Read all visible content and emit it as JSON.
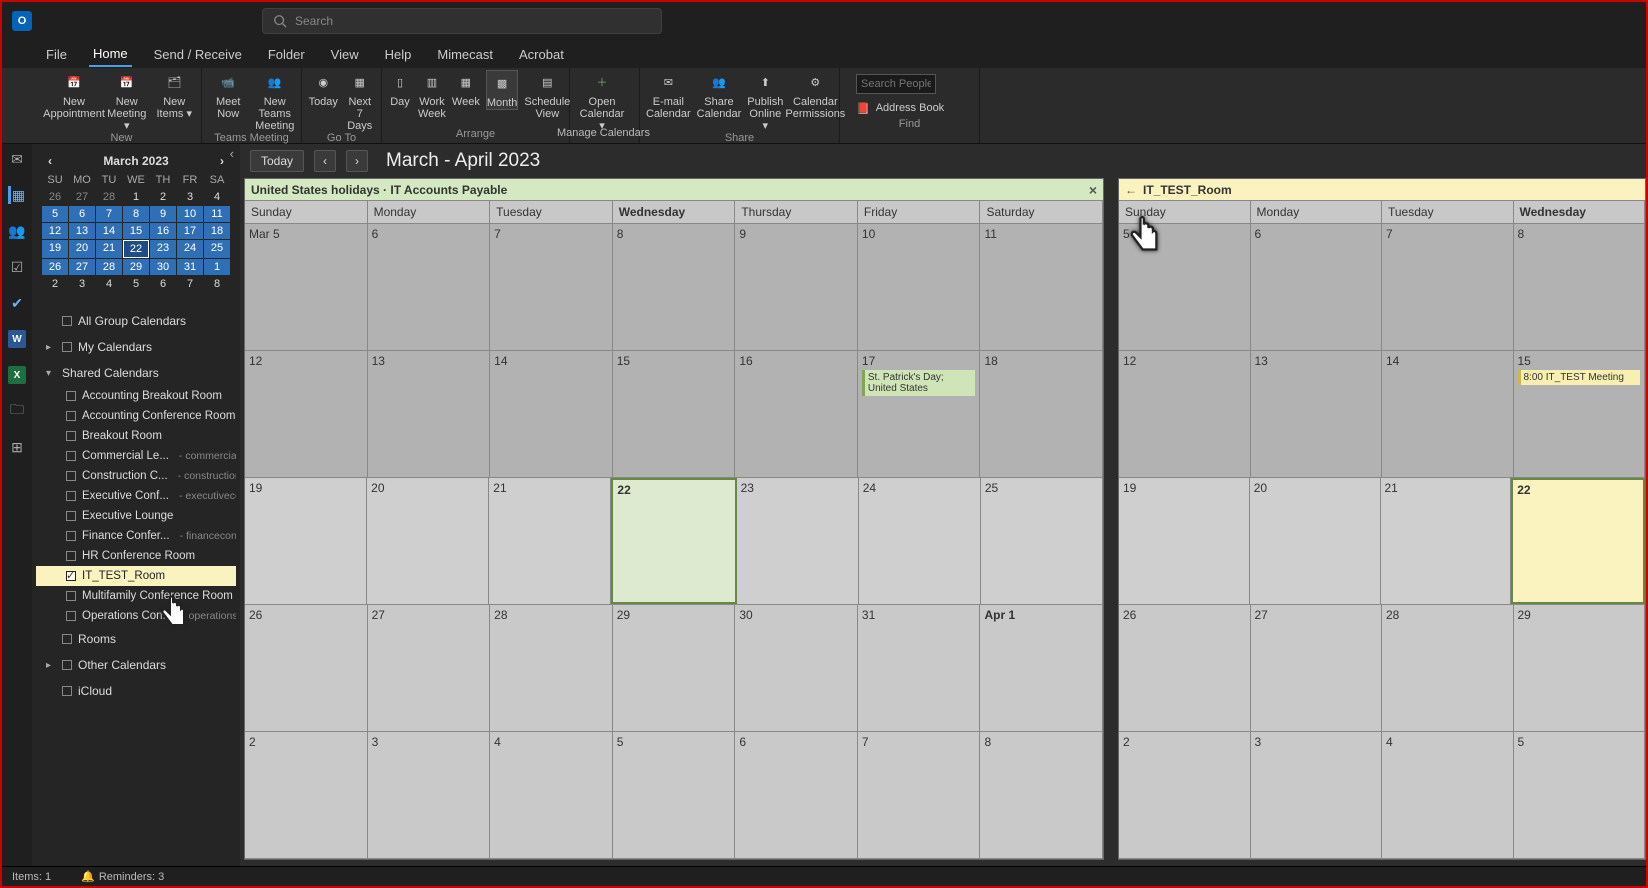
{
  "titlebar": {
    "search_placeholder": "Search"
  },
  "menu": [
    "File",
    "Home",
    "Send / Receive",
    "Folder",
    "View",
    "Help",
    "Mimecast",
    "Acrobat"
  ],
  "menu_active_index": 1,
  "ribbon": {
    "new": {
      "label": "New",
      "buttons": [
        {
          "label": "New Appointment"
        },
        {
          "label": "New Meeting ▾"
        },
        {
          "label": "New Items ▾"
        }
      ]
    },
    "teams": {
      "label": "Teams Meeting",
      "buttons": [
        {
          "label": "Meet Now"
        },
        {
          "label": "New Teams Meeting"
        }
      ]
    },
    "goto": {
      "label": "Go To",
      "buttons": [
        {
          "label": "Today"
        },
        {
          "label": "Next 7 Days"
        }
      ]
    },
    "arrange": {
      "label": "Arrange",
      "buttons": [
        {
          "label": "Day"
        },
        {
          "label": "Work Week"
        },
        {
          "label": "Week"
        },
        {
          "label": "Month"
        },
        {
          "label": "Schedule View"
        }
      ],
      "extra": "Manage Calendars"
    },
    "open": {
      "buttons": [
        {
          "label": "Open Calendar ▾"
        }
      ]
    },
    "share": {
      "label": "Share",
      "buttons": [
        {
          "label": "E-mail Calendar"
        },
        {
          "label": "Share Calendar"
        },
        {
          "label": "Publish Online ▾"
        },
        {
          "label": "Calendar Permissions"
        }
      ]
    },
    "find": {
      "label": "Find",
      "search_placeholder": "Search People",
      "address_book": "Address Book"
    }
  },
  "mini": {
    "title": "March 2023",
    "dow": [
      "SU",
      "MO",
      "TU",
      "WE",
      "TH",
      "FR",
      "SA"
    ],
    "weeks": [
      [
        {
          "n": "26",
          "o": true
        },
        {
          "n": "27",
          "o": true
        },
        {
          "n": "28",
          "o": true
        },
        {
          "n": "1"
        },
        {
          "n": "2"
        },
        {
          "n": "3"
        },
        {
          "n": "4"
        }
      ],
      [
        {
          "n": "5",
          "c": true
        },
        {
          "n": "6",
          "c": true
        },
        {
          "n": "7",
          "c": true
        },
        {
          "n": "8",
          "c": true
        },
        {
          "n": "9",
          "c": true
        },
        {
          "n": "10",
          "c": true
        },
        {
          "n": "11",
          "c": true
        }
      ],
      [
        {
          "n": "12",
          "c": true
        },
        {
          "n": "13",
          "c": true
        },
        {
          "n": "14",
          "c": true
        },
        {
          "n": "15",
          "c": true
        },
        {
          "n": "16",
          "c": true
        },
        {
          "n": "17",
          "c": true
        },
        {
          "n": "18",
          "c": true
        }
      ],
      [
        {
          "n": "19",
          "c": true
        },
        {
          "n": "20",
          "c": true
        },
        {
          "n": "21",
          "c": true
        },
        {
          "n": "22",
          "c": true,
          "t": true
        },
        {
          "n": "23",
          "c": true
        },
        {
          "n": "24",
          "c": true
        },
        {
          "n": "25",
          "c": true
        }
      ],
      [
        {
          "n": "26",
          "c": true
        },
        {
          "n": "27",
          "c": true
        },
        {
          "n": "28",
          "c": true
        },
        {
          "n": "29",
          "c": true
        },
        {
          "n": "30",
          "c": true
        },
        {
          "n": "31",
          "c": true
        },
        {
          "n": "1",
          "c": true
        }
      ],
      [
        {
          "n": "2"
        },
        {
          "n": "3"
        },
        {
          "n": "4"
        },
        {
          "n": "5"
        },
        {
          "n": "6"
        },
        {
          "n": "7"
        },
        {
          "n": "8"
        }
      ]
    ]
  },
  "tree": {
    "all_group": "All Group Calendars",
    "my": "My Calendars",
    "shared": "Shared Calendars",
    "shared_items": [
      {
        "l": "Accounting Breakout Room"
      },
      {
        "l": "Accounting Conference Room"
      },
      {
        "l": "Breakout Room"
      },
      {
        "l": "Commercial Le...",
        "s": "- commercialco..."
      },
      {
        "l": "Construction C...",
        "s": "- constructionc..."
      },
      {
        "l": "Executive Conf...",
        "s": "- executiveconf..."
      },
      {
        "l": "Executive Lounge"
      },
      {
        "l": "Finance Confer...",
        "s": "- financeconfer..."
      },
      {
        "l": "HR Conference Room"
      },
      {
        "l": "IT_TEST_Room",
        "sel": true
      },
      {
        "l": "Multifamily Conference Room"
      },
      {
        "l": "Operations Con...",
        "s": "- operationsco..."
      }
    ],
    "rooms": "Rooms",
    "other": "Other Calendars",
    "icloud": "iCloud"
  },
  "calheader": {
    "today": "Today",
    "range": "March - April 2023"
  },
  "panel1": {
    "title": "United States holidays · IT Accounts Payable"
  },
  "panel2": {
    "title": "IT_TEST_Room"
  },
  "dow": [
    "Sunday",
    "Monday",
    "Tuesday",
    "Wednesday",
    "Thursday",
    "Friday",
    "Saturday"
  ],
  "dow_today_index": 3,
  "dow2": [
    "Sunday",
    "Monday",
    "Tuesday",
    "Wednesday"
  ],
  "grid1": [
    [
      "Mar 5",
      "6",
      "7",
      "8",
      "9",
      "10",
      "11"
    ],
    [
      "12",
      "13",
      "14",
      "15",
      "16",
      "17",
      "18"
    ],
    [
      "19",
      "20",
      "21",
      "22",
      "23",
      "24",
      "25"
    ],
    [
      "26",
      "27",
      "28",
      "29",
      "30",
      "31",
      "Apr 1"
    ],
    [
      "2",
      "3",
      "4",
      "5",
      "6",
      "7",
      "8"
    ]
  ],
  "grid2": [
    [
      "5",
      "6",
      "7",
      "8"
    ],
    [
      "12",
      "13",
      "14",
      "15"
    ],
    [
      "19",
      "20",
      "21",
      "22"
    ],
    [
      "26",
      "27",
      "28",
      "29"
    ],
    [
      "2",
      "3",
      "4",
      "5"
    ]
  ],
  "event1": {
    "row": 1,
    "col": 5,
    "text": "St. Patrick's Day; United States"
  },
  "event2": {
    "row": 1,
    "col": 3,
    "text": "8:00 IT_TEST Meeting"
  },
  "status": {
    "items": "Items: 1",
    "reminders": "Reminders: 3"
  }
}
